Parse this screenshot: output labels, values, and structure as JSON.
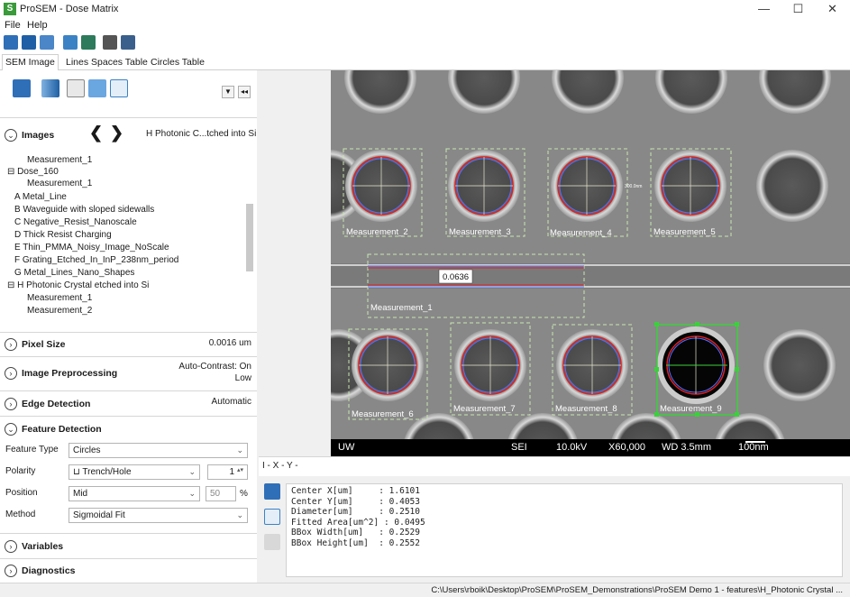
{
  "window": {
    "title": "ProSEM - Dose Matrix",
    "app_icon": "S",
    "minimize": "—",
    "maximize": "☐",
    "close": "✕"
  },
  "menu": [
    "File",
    "Help"
  ],
  "tabs": [
    "SEM Image",
    "Lines Spaces Table",
    "Circles Table"
  ],
  "images_section": {
    "title": "Images",
    "current": "H Photonic C...tched into Si",
    "nav_prev": "❮",
    "nav_next": "❯"
  },
  "tree": [
    {
      "label": "Measurement_1",
      "level": 2
    },
    {
      "label": "Dose_160",
      "level": 1
    },
    {
      "label": "Measurement_1",
      "level": 2
    },
    {
      "label": "A Metal_Line",
      "level": 1
    },
    {
      "label": "B  Waveguide with sloped sidewalls",
      "level": 1
    },
    {
      "label": "C  Negative_Resist_Nanoscale",
      "level": 1
    },
    {
      "label": "D  Thick Resist Charging",
      "level": 1
    },
    {
      "label": "E  Thin_PMMA_Noisy_Image_NoScale",
      "level": 1
    },
    {
      "label": "F  Grating_Etched_In_InP_238nm_period",
      "level": 1
    },
    {
      "label": "G  Metal_Lines_Nano_Shapes",
      "level": 1
    },
    {
      "label": "H  Photonic Crystal etched into Si",
      "level": 1
    },
    {
      "label": "Measurement_1",
      "level": 2
    },
    {
      "label": "Measurement_2",
      "level": 2
    }
  ],
  "sections": {
    "pixel_size": {
      "title": "Pixel Size",
      "value": "0.0016 um"
    },
    "preprocessing": {
      "title": "Image Preprocessing",
      "value_line1": "Auto-Contrast: On",
      "value_line2": "Low"
    },
    "edge_detection": {
      "title": "Edge Detection",
      "value": "Automatic"
    },
    "feature_detection": {
      "title": "Feature Detection"
    },
    "variables": {
      "title": "Variables"
    },
    "diagnostics": {
      "title": "Diagnostics"
    }
  },
  "feature_form": {
    "feature_type_label": "Feature Type",
    "feature_type_value": "Circles",
    "polarity_label": "Polarity",
    "polarity_value": "Trench/Hole",
    "polarity_num": "1",
    "position_label": "Position",
    "position_value": "Mid",
    "position_pct": "50",
    "pct_sign": "%",
    "method_label": "Method",
    "method_value": "Sigmoidal Fit"
  },
  "sem": {
    "measurements": [
      "Measurement_2",
      "Measurement_3",
      "Measurement_4",
      "Measurement_5",
      "Measurement_1",
      "Measurement_6",
      "Measurement_7",
      "Measurement_8",
      "Measurement_9"
    ],
    "line_value": "0.0636",
    "diameter_annotation": "300.0nm",
    "bar": {
      "org": "UW",
      "detector": "SEI",
      "voltage": "10.0kV",
      "mag": "X60,000",
      "wd": "WD 3.5mm",
      "scale": "100nm"
    }
  },
  "coord_bar": "I - X - Y -",
  "output": [
    "Center X[um]     : 1.6101",
    "Center Y[um]     : 0.4053",
    "Diameter[um]     : 0.2510",
    "Fitted Area[um^2] : 0.0495",
    "BBox Width[um]   : 0.2529",
    "BBox Height[um]  : 0.2552"
  ],
  "status": "C:\\Users\\rboik\\Desktop\\ProSEM\\ProSEM_Demonstrations\\ProSEM Demo 1 - features\\H_Photonic Crystal ...",
  "colors": {
    "accent_green": "#3a9b3a",
    "toolbar_blue": "#2f6fb7",
    "measure_box": "#c8e6b0",
    "selected_box": "#3ad13a"
  }
}
